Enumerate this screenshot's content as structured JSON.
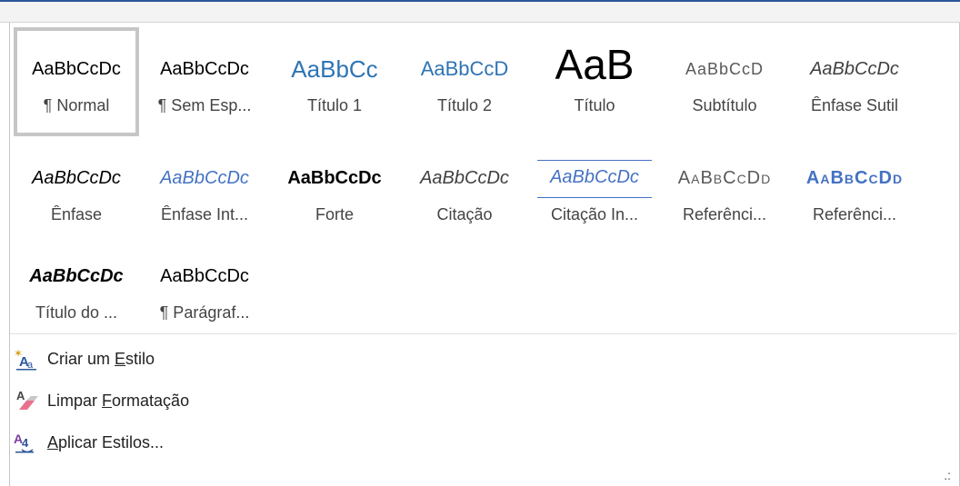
{
  "styles": [
    {
      "sample": "AaBbCcDc",
      "label": "¶ Normal"
    },
    {
      "sample": "AaBbCcDc",
      "label": "¶ Sem Esp..."
    },
    {
      "sample": "AaBbCc",
      "label": "Título 1"
    },
    {
      "sample": "AaBbCcD",
      "label": "Título 2"
    },
    {
      "sample": "AaB",
      "label": "Título"
    },
    {
      "sample": "AaBbCcD",
      "label": "Subtítulo"
    },
    {
      "sample": "AaBbCcDc",
      "label": "Ênfase Sutil"
    },
    {
      "sample": "AaBbCcDc",
      "label": "Ênfase"
    },
    {
      "sample": "AaBbCcDc",
      "label": "Ênfase Int..."
    },
    {
      "sample": "AaBbCcDc",
      "label": "Forte"
    },
    {
      "sample": "AaBbCcDc",
      "label": "Citação"
    },
    {
      "sample": "AaBbCcDc",
      "label": "Citação In..."
    },
    {
      "sample": "AaBbCcDd",
      "label": "Referênci..."
    },
    {
      "sample": "AaBbCcDd",
      "label": "Referênci..."
    },
    {
      "sample": "AaBbCcDc",
      "label": "Título do ..."
    },
    {
      "sample": "AaBbCcDc",
      "label": "¶ Parágraf..."
    }
  ],
  "commands": {
    "create": {
      "pre": "Criar um ",
      "accel": "E",
      "post": "stilo",
      "icon": "create-style-icon"
    },
    "clear": {
      "pre": "Limpar ",
      "accel": "F",
      "post": "ormatação",
      "icon": "clear-formatting-icon"
    },
    "apply": {
      "pre": "",
      "accel": "A",
      "post": "plicar Estilos...",
      "icon": "apply-styles-icon"
    }
  },
  "colors": {
    "accent": "#2b579a",
    "heading_blue": "#2e74b5",
    "emphasis_blue": "#4472c4",
    "selection_border": "#c6c6c6"
  }
}
